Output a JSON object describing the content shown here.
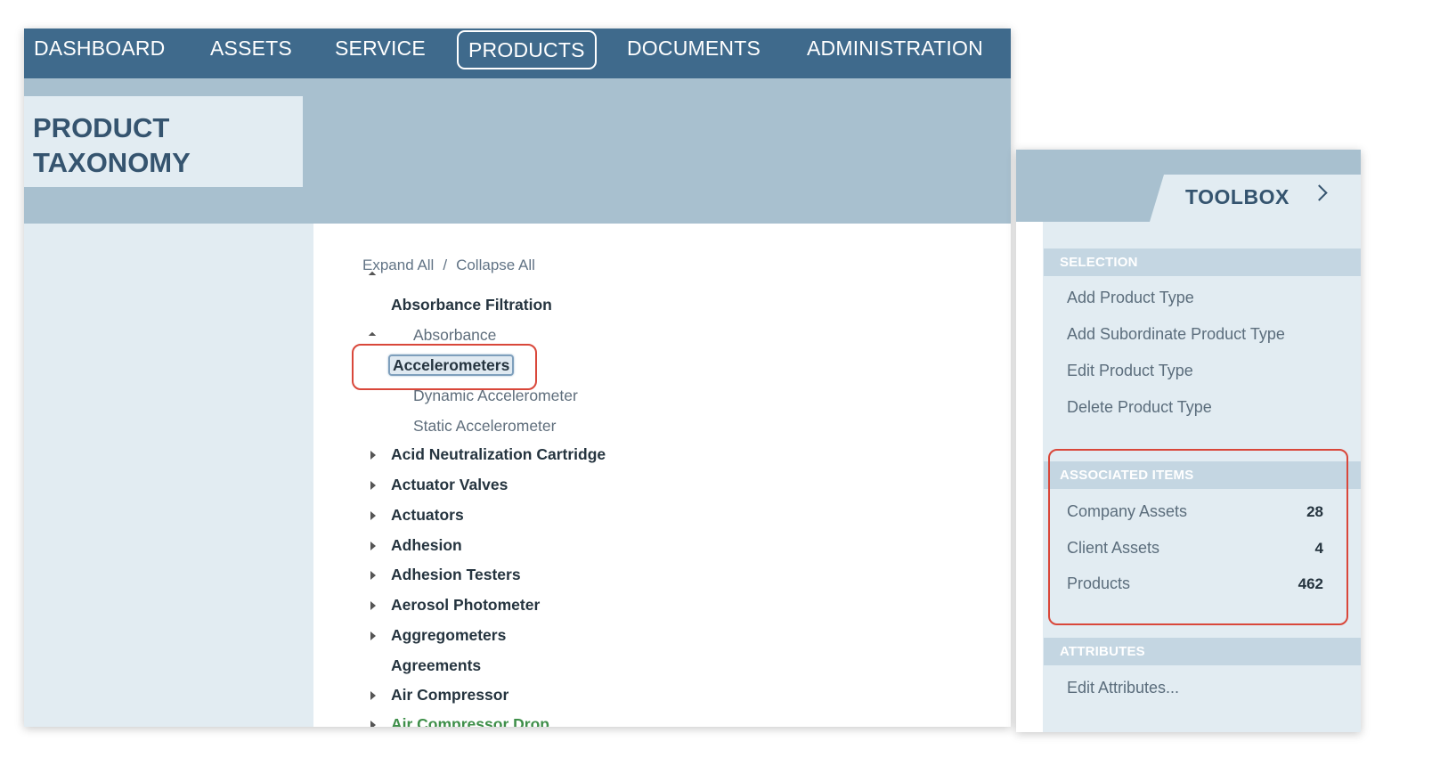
{
  "nav": {
    "items": [
      {
        "label": "DASHBOARD"
      },
      {
        "label": "ASSETS"
      },
      {
        "label": "SERVICE"
      },
      {
        "label": "PRODUCTS",
        "active": true
      },
      {
        "label": "DOCUMENTS"
      },
      {
        "label": "ADMINISTRATION"
      }
    ]
  },
  "page": {
    "title_line1": "PRODUCT",
    "title_line2": "TAXONOMY"
  },
  "tree": {
    "expand_all": "Expand All",
    "separator": "/",
    "collapse_all": "Collapse All",
    "nodes": [
      {
        "label": "Absorbance Filtration",
        "kind": "parent",
        "state": "expanded"
      },
      {
        "label": "Absorbance",
        "kind": "child"
      },
      {
        "label": "Accelerometers",
        "kind": "parent",
        "state": "expanded",
        "selected": true
      },
      {
        "label": "Dynamic Accelerometer",
        "kind": "child"
      },
      {
        "label": "Static Accelerometer",
        "kind": "child"
      },
      {
        "label": "Acid Neutralization Cartridge",
        "kind": "parent",
        "state": "collapsed"
      },
      {
        "label": "Actuator Valves",
        "kind": "parent",
        "state": "collapsed"
      },
      {
        "label": "Actuators",
        "kind": "parent",
        "state": "collapsed"
      },
      {
        "label": "Adhesion",
        "kind": "parent",
        "state": "collapsed"
      },
      {
        "label": "Adhesion Testers",
        "kind": "parent",
        "state": "collapsed"
      },
      {
        "label": "Aerosol Photometer",
        "kind": "parent",
        "state": "collapsed"
      },
      {
        "label": "Aggregometers",
        "kind": "parent",
        "state": "collapsed"
      },
      {
        "label": "Agreements",
        "kind": "parent",
        "state": "leaf"
      },
      {
        "label": "Air Compressor",
        "kind": "parent",
        "state": "collapsed"
      },
      {
        "label": "Air Compressor Drop",
        "kind": "parent",
        "state": "collapsed",
        "partially_visible": true
      }
    ]
  },
  "toolbox": {
    "title": "TOOLBOX",
    "sections": {
      "selection": {
        "header": "SELECTION",
        "items": [
          "Add Product Type",
          "Add Subordinate Product Type",
          "Edit Product Type",
          "Delete Product Type"
        ]
      },
      "associated": {
        "header": "ASSOCIATED ITEMS",
        "items": [
          {
            "label": "Company Assets",
            "count": "28"
          },
          {
            "label": "Client Assets",
            "count": "4"
          },
          {
            "label": "Products",
            "count": "462"
          }
        ]
      },
      "attributes": {
        "header": "ATTRIBUTES",
        "items": [
          "Edit Attributes..."
        ]
      }
    }
  },
  "colors": {
    "nav_bg": "#3f6a8c",
    "header_bg": "#a8c0cf",
    "panel_bg": "#e2ecf2",
    "title_text": "#35546f",
    "highlight_red": "#d9473a",
    "green_text": "#3f8f4a"
  }
}
